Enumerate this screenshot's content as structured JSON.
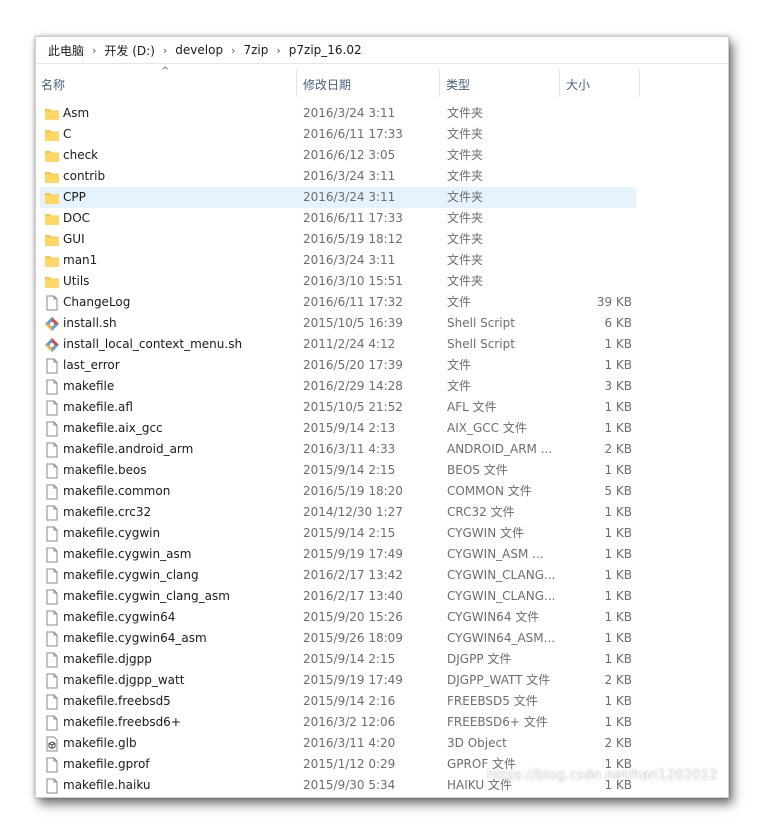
{
  "breadcrumb": [
    "此电脑",
    "开发 (D:)",
    "develop",
    "7zip",
    "p7zip_16.02"
  ],
  "columns": {
    "name": "名称",
    "date": "修改日期",
    "type": "类型",
    "size": "大小"
  },
  "files": [
    {
      "name": "Asm",
      "date": "2016/3/24 3:11",
      "type": "文件夹",
      "size": "",
      "icon": "folder-icon",
      "selected": false
    },
    {
      "name": "C",
      "date": "2016/6/11 17:33",
      "type": "文件夹",
      "size": "",
      "icon": "folder-icon",
      "selected": false
    },
    {
      "name": "check",
      "date": "2016/6/12 3:05",
      "type": "文件夹",
      "size": "",
      "icon": "folder-icon",
      "selected": false
    },
    {
      "name": "contrib",
      "date": "2016/3/24 3:11",
      "type": "文件夹",
      "size": "",
      "icon": "folder-icon",
      "selected": false
    },
    {
      "name": "CPP",
      "date": "2016/3/24 3:11",
      "type": "文件夹",
      "size": "",
      "icon": "folder-icon",
      "selected": true
    },
    {
      "name": "DOC",
      "date": "2016/6/11 17:33",
      "type": "文件夹",
      "size": "",
      "icon": "folder-icon",
      "selected": false
    },
    {
      "name": "GUI",
      "date": "2016/5/19 18:12",
      "type": "文件夹",
      "size": "",
      "icon": "folder-icon",
      "selected": false
    },
    {
      "name": "man1",
      "date": "2016/3/24 3:11",
      "type": "文件夹",
      "size": "",
      "icon": "folder-icon",
      "selected": false
    },
    {
      "name": "Utils",
      "date": "2016/3/10 15:51",
      "type": "文件夹",
      "size": "",
      "icon": "folder-icon",
      "selected": false
    },
    {
      "name": "ChangeLog",
      "date": "2016/6/11 17:32",
      "type": "文件",
      "size": "39 KB",
      "icon": "file-icon",
      "selected": false
    },
    {
      "name": "install.sh",
      "date": "2015/10/5 16:39",
      "type": "Shell Script",
      "size": "6 KB",
      "icon": "shell-script-icon",
      "selected": false
    },
    {
      "name": "install_local_context_menu.sh",
      "date": "2011/2/24 4:12",
      "type": "Shell Script",
      "size": "1 KB",
      "icon": "shell-script-icon",
      "selected": false
    },
    {
      "name": "last_error",
      "date": "2016/5/20 17:39",
      "type": "文件",
      "size": "1 KB",
      "icon": "file-icon",
      "selected": false
    },
    {
      "name": "makefile",
      "date": "2016/2/29 14:28",
      "type": "文件",
      "size": "3 KB",
      "icon": "file-icon",
      "selected": false
    },
    {
      "name": "makefile.afl",
      "date": "2015/10/5 21:52",
      "type": "AFL 文件",
      "size": "1 KB",
      "icon": "file-icon",
      "selected": false
    },
    {
      "name": "makefile.aix_gcc",
      "date": "2015/9/14 2:13",
      "type": "AIX_GCC 文件",
      "size": "1 KB",
      "icon": "file-icon",
      "selected": false
    },
    {
      "name": "makefile.android_arm",
      "date": "2016/3/11 4:33",
      "type": "ANDROID_ARM ...",
      "size": "2 KB",
      "icon": "file-icon",
      "selected": false
    },
    {
      "name": "makefile.beos",
      "date": "2015/9/14 2:15",
      "type": "BEOS 文件",
      "size": "1 KB",
      "icon": "file-icon",
      "selected": false
    },
    {
      "name": "makefile.common",
      "date": "2016/5/19 18:20",
      "type": "COMMON 文件",
      "size": "5 KB",
      "icon": "file-icon",
      "selected": false
    },
    {
      "name": "makefile.crc32",
      "date": "2014/12/30 1:27",
      "type": "CRC32 文件",
      "size": "1 KB",
      "icon": "file-icon",
      "selected": false
    },
    {
      "name": "makefile.cygwin",
      "date": "2015/9/14 2:15",
      "type": "CYGWIN 文件",
      "size": "1 KB",
      "icon": "file-icon",
      "selected": false
    },
    {
      "name": "makefile.cygwin_asm",
      "date": "2015/9/19 17:49",
      "type": "CYGWIN_ASM ...",
      "size": "1 KB",
      "icon": "file-icon",
      "selected": false
    },
    {
      "name": "makefile.cygwin_clang",
      "date": "2016/2/17 13:42",
      "type": "CYGWIN_CLANG...",
      "size": "1 KB",
      "icon": "file-icon",
      "selected": false
    },
    {
      "name": "makefile.cygwin_clang_asm",
      "date": "2016/2/17 13:40",
      "type": "CYGWIN_CLANG...",
      "size": "1 KB",
      "icon": "file-icon",
      "selected": false
    },
    {
      "name": "makefile.cygwin64",
      "date": "2015/9/20 15:26",
      "type": "CYGWIN64 文件",
      "size": "1 KB",
      "icon": "file-icon",
      "selected": false
    },
    {
      "name": "makefile.cygwin64_asm",
      "date": "2015/9/26 18:09",
      "type": "CYGWIN64_ASM...",
      "size": "1 KB",
      "icon": "file-icon",
      "selected": false
    },
    {
      "name": "makefile.djgpp",
      "date": "2015/9/14 2:15",
      "type": "DJGPP 文件",
      "size": "1 KB",
      "icon": "file-icon",
      "selected": false
    },
    {
      "name": "makefile.djgpp_watt",
      "date": "2015/9/19 17:49",
      "type": "DJGPP_WATT 文件",
      "size": "2 KB",
      "icon": "file-icon",
      "selected": false
    },
    {
      "name": "makefile.freebsd5",
      "date": "2015/9/14 2:16",
      "type": "FREEBSD5 文件",
      "size": "1 KB",
      "icon": "file-icon",
      "selected": false
    },
    {
      "name": "makefile.freebsd6+",
      "date": "2016/3/2 12:06",
      "type": "FREEBSD6+ 文件",
      "size": "1 KB",
      "icon": "file-icon",
      "selected": false
    },
    {
      "name": "makefile.glb",
      "date": "2016/3/11 4:20",
      "type": "3D Object",
      "size": "2 KB",
      "icon": "3d-object-icon",
      "selected": false
    },
    {
      "name": "makefile.gprof",
      "date": "2015/1/12 0:29",
      "type": "GPROF 文件",
      "size": "1 KB",
      "icon": "file-icon",
      "selected": false
    },
    {
      "name": "makefile.haiku",
      "date": "2015/9/30 5:34",
      "type": "HAIKU 文件",
      "size": "1 KB",
      "icon": "file-icon",
      "selected": false
    }
  ],
  "watermark": "https://blog.csdn.net/han1202012",
  "colors": {
    "selected_row": "#e5f3ff",
    "folder": "#f5c84c",
    "header_text": "#4c607a"
  }
}
